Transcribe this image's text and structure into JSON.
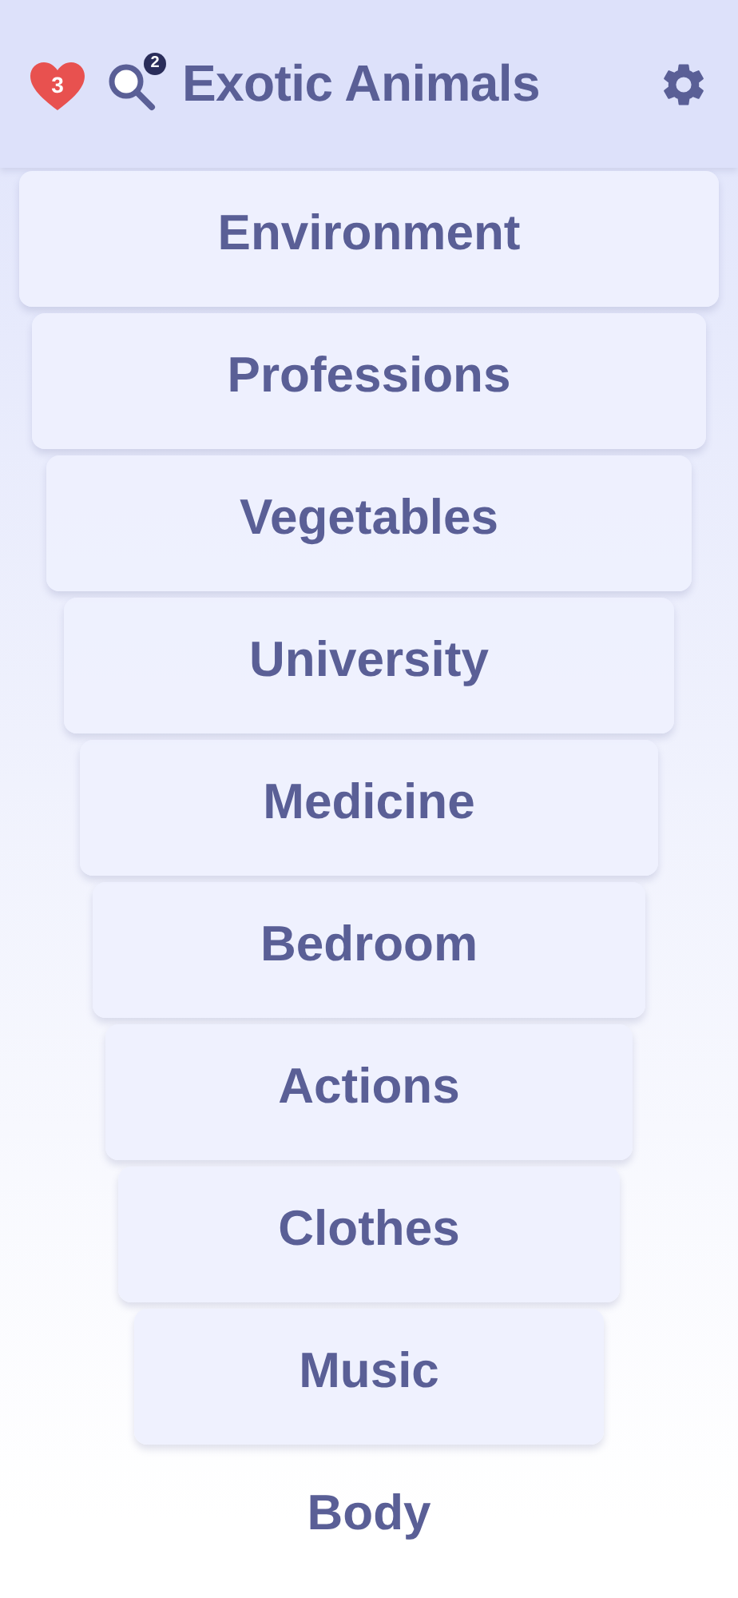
{
  "header": {
    "lives": "3",
    "hints": "2",
    "title": "Exotic Animals"
  },
  "categories": [
    {
      "label": "Environment"
    },
    {
      "label": "Professions"
    },
    {
      "label": "Vegetables"
    },
    {
      "label": "University"
    },
    {
      "label": "Medicine"
    },
    {
      "label": "Bedroom"
    },
    {
      "label": "Actions"
    },
    {
      "label": "Clothes"
    },
    {
      "label": "Music"
    },
    {
      "label": "Body"
    }
  ]
}
